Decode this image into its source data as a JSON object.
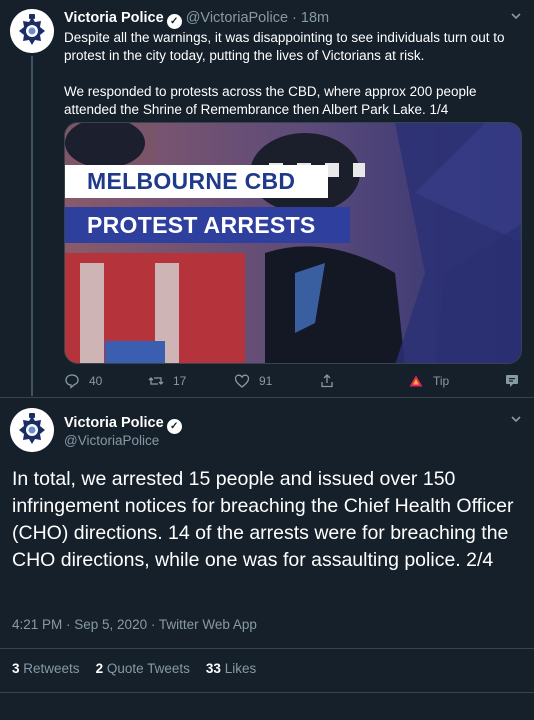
{
  "tweet1": {
    "name": "Victoria Police",
    "handle": "@VictoriaPolice",
    "separator": "·",
    "time": "18m",
    "text_p1": "Despite all the warnings, it was disappointing to see individuals turn out to protest in the city today, putting the lives of Victorians at risk.",
    "text_p2": "We responded to protests across the CBD, where approx 200 people attended the Shrine of Remembrance then Albert Park Lake. 1/4",
    "media": {
      "line1": "MELBOURNE CBD",
      "line2": "PROTEST ARRESTS"
    },
    "actions": {
      "replies": "40",
      "retweets": "17",
      "likes": "91",
      "tip": "Tip"
    }
  },
  "tweet2": {
    "name": "Victoria Police",
    "handle": "@VictoriaPolice",
    "text": "In total, we arrested 15 people and issued over 150 infringement notices for breaching the Chief Health Officer (CHO) directions. 14 of the arrests were for breaching the CHO directions, while one was for assaulting police. 2/4",
    "meta": "4:21 PM · Sep 5, 2020 · Twitter Web App",
    "stats": {
      "retweets_count": "3",
      "retweets_label": "Retweets",
      "quotes_count": "2",
      "quotes_label": "Quote Tweets",
      "likes_count": "33",
      "likes_label": "Likes"
    }
  },
  "colors": {
    "background": "#15202b",
    "muted": "#8899a6",
    "border": "#38444d"
  }
}
